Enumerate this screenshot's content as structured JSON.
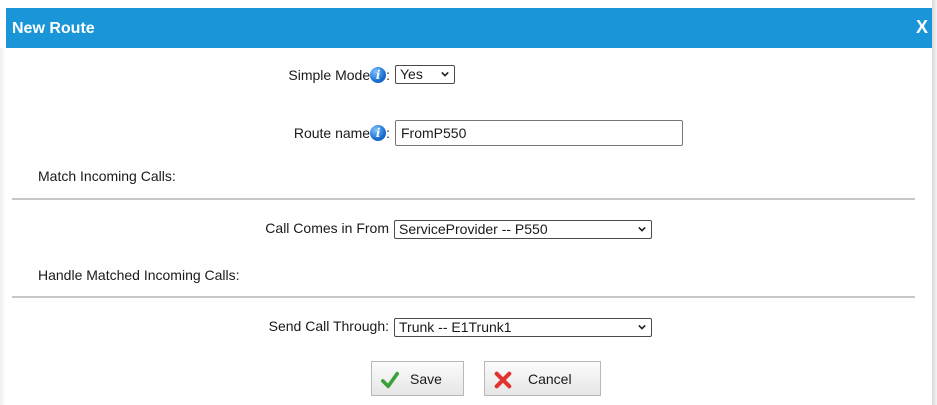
{
  "dialog": {
    "title": "New Route",
    "close": "X"
  },
  "form": {
    "simple_mode": {
      "label": "Simple Mode",
      "suffix": ":",
      "value": "Yes"
    },
    "route_name": {
      "label": "Route name",
      "suffix": ":",
      "value": "FromP550"
    },
    "match_section": "Match Incoming Calls:",
    "call_from": {
      "label": "Call Comes in From",
      "value": "ServiceProvider -- P550"
    },
    "handle_section": "Handle Matched Incoming Calls:",
    "send_through": {
      "label": "Send Call Through:",
      "value": "Trunk -- E1Trunk1"
    }
  },
  "buttons": {
    "save": "Save",
    "cancel": "Cancel"
  },
  "icons": {
    "info": "info-icon",
    "save": "checkmark-icon",
    "cancel": "x-mark-icon",
    "dropdown": "chevron-down-icon"
  },
  "colors": {
    "title_bar": "#1a96d8",
    "title_text": "#ffffff",
    "check": "#3aa13a",
    "cancel_x": "#e0322f",
    "info": "#1a6fd0"
  }
}
